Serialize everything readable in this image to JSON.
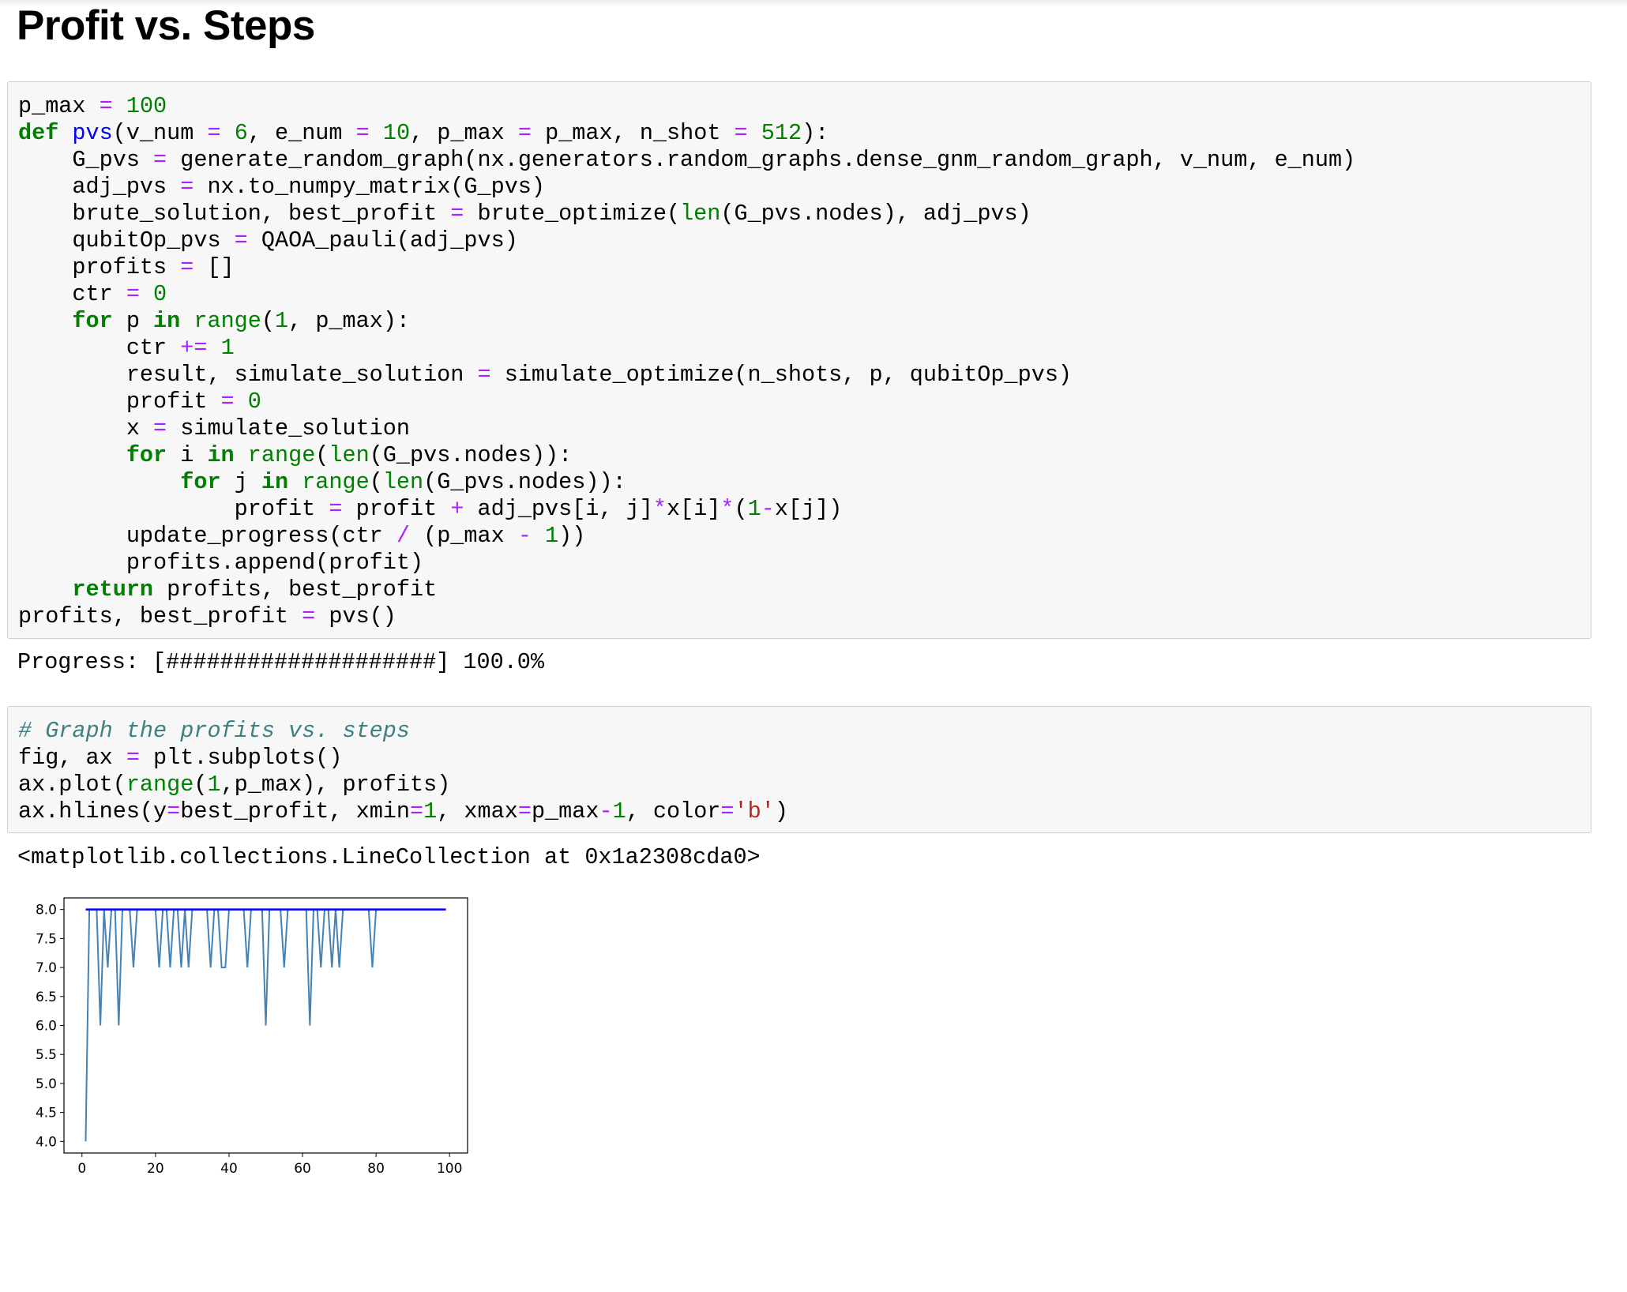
{
  "page": {
    "title": "Profit vs. Steps"
  },
  "cell1": {
    "lines": [
      [
        [
          "t",
          "p_max "
        ],
        [
          "op",
          "="
        ],
        [
          "t",
          " "
        ],
        [
          "num",
          "100"
        ]
      ],
      [
        [
          "kw",
          "def"
        ],
        [
          "t",
          " "
        ],
        [
          "fn",
          "pvs"
        ],
        [
          "t",
          "(v_num "
        ],
        [
          "op",
          "="
        ],
        [
          "t",
          " "
        ],
        [
          "num",
          "6"
        ],
        [
          "t",
          ", e_num "
        ],
        [
          "op",
          "="
        ],
        [
          "t",
          " "
        ],
        [
          "num",
          "10"
        ],
        [
          "t",
          ", p_max "
        ],
        [
          "op",
          "="
        ],
        [
          "t",
          " p_max, n_shot "
        ],
        [
          "op",
          "="
        ],
        [
          "t",
          " "
        ],
        [
          "num",
          "512"
        ],
        [
          "t",
          "):"
        ]
      ],
      [
        [
          "t",
          "    G_pvs "
        ],
        [
          "op",
          "="
        ],
        [
          "t",
          " generate_random_graph(nx.generators.random_graphs.dense_gnm_random_graph, v_num, e_num)"
        ]
      ],
      [
        [
          "t",
          "    adj_pvs "
        ],
        [
          "op",
          "="
        ],
        [
          "t",
          " nx.to_numpy_matrix(G_pvs)"
        ]
      ],
      [
        [
          "t",
          "    brute_solution, best_profit "
        ],
        [
          "op",
          "="
        ],
        [
          "t",
          " brute_optimize("
        ],
        [
          "bi",
          "len"
        ],
        [
          "t",
          "(G_pvs.nodes), adj_pvs)"
        ]
      ],
      [
        [
          "t",
          "    qubitOp_pvs "
        ],
        [
          "op",
          "="
        ],
        [
          "t",
          " QAOA_pauli(adj_pvs)"
        ]
      ],
      [
        [
          "t",
          "    profits "
        ],
        [
          "op",
          "="
        ],
        [
          "t",
          " []"
        ]
      ],
      [
        [
          "t",
          "    ctr "
        ],
        [
          "op",
          "="
        ],
        [
          "t",
          " "
        ],
        [
          "num",
          "0"
        ]
      ],
      [
        [
          "t",
          "    "
        ],
        [
          "kw",
          "for"
        ],
        [
          "t",
          " p "
        ],
        [
          "kw",
          "in"
        ],
        [
          "t",
          " "
        ],
        [
          "bi",
          "range"
        ],
        [
          "t",
          "("
        ],
        [
          "num",
          "1"
        ],
        [
          "t",
          ", p_max):"
        ]
      ],
      [
        [
          "t",
          "        ctr "
        ],
        [
          "op",
          "+="
        ],
        [
          "t",
          " "
        ],
        [
          "num",
          "1"
        ]
      ],
      [
        [
          "t",
          "        result, simulate_solution "
        ],
        [
          "op",
          "="
        ],
        [
          "t",
          " simulate_optimize(n_shots, p, qubitOp_pvs)"
        ]
      ],
      [
        [
          "t",
          "        profit "
        ],
        [
          "op",
          "="
        ],
        [
          "t",
          " "
        ],
        [
          "num",
          "0"
        ]
      ],
      [
        [
          "t",
          "        x "
        ],
        [
          "op",
          "="
        ],
        [
          "t",
          " simulate_solution"
        ]
      ],
      [
        [
          "t",
          "        "
        ],
        [
          "kw",
          "for"
        ],
        [
          "t",
          " i "
        ],
        [
          "kw",
          "in"
        ],
        [
          "t",
          " "
        ],
        [
          "bi",
          "range"
        ],
        [
          "t",
          "("
        ],
        [
          "bi",
          "len"
        ],
        [
          "t",
          "(G_pvs.nodes)):"
        ]
      ],
      [
        [
          "t",
          "            "
        ],
        [
          "kw",
          "for"
        ],
        [
          "t",
          " j "
        ],
        [
          "kw",
          "in"
        ],
        [
          "t",
          " "
        ],
        [
          "bi",
          "range"
        ],
        [
          "t",
          "("
        ],
        [
          "bi",
          "len"
        ],
        [
          "t",
          "(G_pvs.nodes)):"
        ]
      ],
      [
        [
          "t",
          "                profit "
        ],
        [
          "op",
          "="
        ],
        [
          "t",
          " profit "
        ],
        [
          "op",
          "+"
        ],
        [
          "t",
          " adj_pvs[i, j]"
        ],
        [
          "op",
          "*"
        ],
        [
          "t",
          "x[i]"
        ],
        [
          "op",
          "*"
        ],
        [
          "t",
          "("
        ],
        [
          "num",
          "1"
        ],
        [
          "op",
          "-"
        ],
        [
          "t",
          "x[j])"
        ]
      ],
      [
        [
          "t",
          "        update_progress(ctr "
        ],
        [
          "op",
          "/"
        ],
        [
          "t",
          " (p_max "
        ],
        [
          "op",
          "-"
        ],
        [
          "t",
          " "
        ],
        [
          "num",
          "1"
        ],
        [
          "t",
          "))"
        ]
      ],
      [
        [
          "t",
          "        profits.append(profit)"
        ]
      ],
      [
        [
          "t",
          "    "
        ],
        [
          "kw",
          "return"
        ],
        [
          "t",
          " profits, best_profit"
        ]
      ],
      [
        [
          "t",
          "profits, best_profit "
        ],
        [
          "op",
          "="
        ],
        [
          "t",
          " pvs()"
        ]
      ]
    ]
  },
  "output1": "Progress: [####################] 100.0%",
  "cell2": {
    "lines": [
      [
        [
          "cm",
          "# Graph the profits vs. steps"
        ]
      ],
      [
        [
          "t",
          "fig, ax "
        ],
        [
          "op",
          "="
        ],
        [
          "t",
          " plt.subplots()"
        ]
      ],
      [
        [
          "t",
          "ax.plot("
        ],
        [
          "bi",
          "range"
        ],
        [
          "t",
          "("
        ],
        [
          "num",
          "1"
        ],
        [
          "t",
          ",p_max), profits)"
        ]
      ],
      [
        [
          "t",
          "ax.hlines(y"
        ],
        [
          "op",
          "="
        ],
        [
          "t",
          "best_profit, xmin"
        ],
        [
          "op",
          "="
        ],
        [
          "num",
          "1"
        ],
        [
          "t",
          ", xmax"
        ],
        [
          "op",
          "="
        ],
        [
          "t",
          "p_max"
        ],
        [
          "op",
          "-"
        ],
        [
          "num",
          "1"
        ],
        [
          "t",
          ", color"
        ],
        [
          "op",
          "="
        ],
        [
          "st",
          "'b'"
        ],
        [
          "t",
          ")"
        ]
      ]
    ]
  },
  "output2": "<matplotlib.collections.LineCollection at 0x1a2308cda0>",
  "colors": {
    "line": "#4682b4",
    "hline": "#0000ff",
    "keyword": "#008000",
    "operator": "#aa22ff",
    "string": "#ba2121",
    "comment": "#408080"
  },
  "chart_data": {
    "type": "line",
    "x": [
      1,
      2,
      3,
      4,
      5,
      6,
      7,
      8,
      9,
      10,
      11,
      12,
      13,
      14,
      15,
      16,
      17,
      18,
      19,
      20,
      21,
      22,
      23,
      24,
      25,
      26,
      27,
      28,
      29,
      30,
      31,
      32,
      33,
      34,
      35,
      36,
      37,
      38,
      39,
      40,
      41,
      42,
      43,
      44,
      45,
      46,
      47,
      48,
      49,
      50,
      51,
      52,
      53,
      54,
      55,
      56,
      57,
      58,
      59,
      60,
      61,
      62,
      63,
      64,
      65,
      66,
      67,
      68,
      69,
      70,
      71,
      72,
      73,
      74,
      75,
      76,
      77,
      78,
      79,
      80,
      81,
      82,
      83,
      84,
      85,
      86,
      87,
      88,
      89,
      90,
      91,
      92,
      93,
      94,
      95,
      96,
      97,
      98,
      99
    ],
    "series": [
      {
        "values": [
          4,
          8,
          8,
          8,
          6,
          8,
          7,
          8,
          8,
          6,
          8,
          8,
          8,
          7,
          8,
          8,
          8,
          8,
          8,
          8,
          7,
          8,
          8,
          7,
          8,
          8,
          7,
          8,
          7,
          8,
          8,
          8,
          8,
          8,
          7,
          8,
          8,
          7,
          7,
          8,
          8,
          8,
          8,
          8,
          7,
          8,
          8,
          8,
          8,
          6,
          8,
          8,
          8,
          8,
          7,
          8,
          8,
          8,
          8,
          8,
          8,
          6,
          8,
          8,
          7,
          8,
          8,
          7,
          8,
          7,
          8,
          8,
          8,
          8,
          8,
          8,
          8,
          8,
          7,
          8,
          8,
          8,
          8,
          8,
          8,
          8,
          8,
          8,
          8,
          8,
          8,
          8,
          8,
          8,
          8,
          8,
          8,
          8,
          8
        ]
      }
    ],
    "hline": {
      "y": 8,
      "xmin": 1,
      "xmax": 99
    },
    "xlim": [
      -4.9,
      104.9
    ],
    "ylim": [
      3.8,
      8.2
    ],
    "xticks": [
      0,
      20,
      40,
      60,
      80,
      100
    ],
    "xtick_labels": [
      "0",
      "20",
      "40",
      "60",
      "80",
      "100"
    ],
    "yticks": [
      4.0,
      4.5,
      5.0,
      5.5,
      6.0,
      6.5,
      7.0,
      7.5,
      8.0
    ],
    "ytick_labels": [
      "4.0",
      "4.5",
      "5.0",
      "5.5",
      "6.0",
      "6.5",
      "7.0",
      "7.5",
      "8.0"
    ],
    "grid": false,
    "title": "",
    "xlabel": "",
    "ylabel": ""
  }
}
